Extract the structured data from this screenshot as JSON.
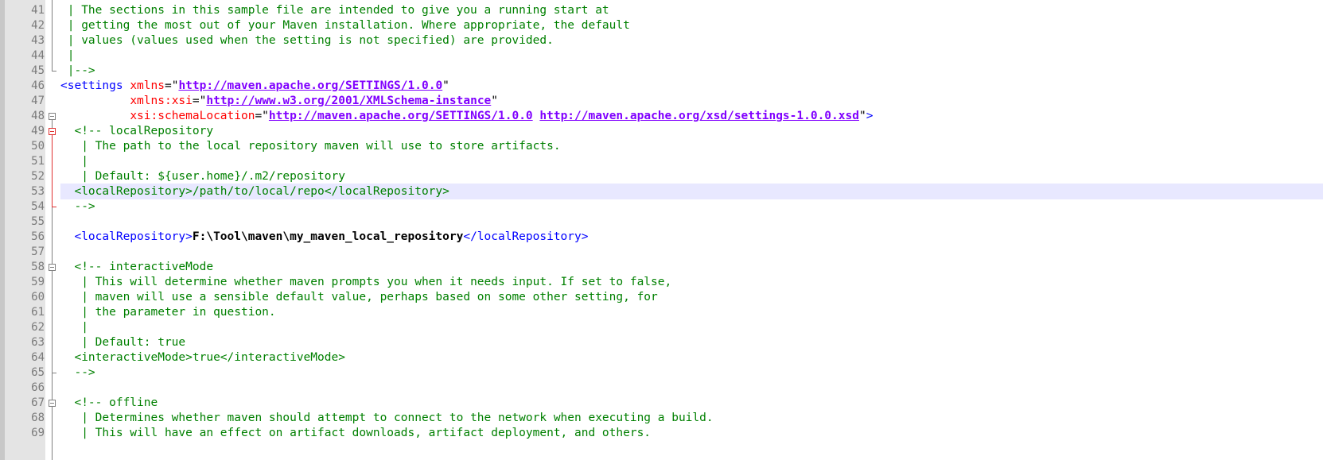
{
  "editor": {
    "colors": {
      "comment": "#008000",
      "tag": "#0000ff",
      "attribute": "#ff0000",
      "url": "#8000ff",
      "current_line": "#e8e8ff",
      "gutter": "#e4e4e4"
    },
    "current_line": 53,
    "lines": [
      {
        "n": "41",
        "indent": "",
        "parts": [
          {
            "c": "comment",
            "t": " | The sections in this sample file are intended to give you a running start at"
          }
        ]
      },
      {
        "n": "42",
        "indent": "",
        "parts": [
          {
            "c": "comment",
            "t": " | getting the most out of your Maven installation. Where appropriate, the default"
          }
        ]
      },
      {
        "n": "43",
        "indent": "",
        "parts": [
          {
            "c": "comment",
            "t": " | values (values used when the setting is not specified) are provided."
          }
        ]
      },
      {
        "n": "44",
        "indent": "",
        "parts": [
          {
            "c": "comment",
            "t": " |"
          }
        ]
      },
      {
        "n": "45",
        "indent": "",
        "parts": [
          {
            "c": "comment",
            "t": " |-->"
          }
        ]
      },
      {
        "n": "46",
        "indent": "",
        "parts": [
          {
            "c": "tag",
            "t": "<settings "
          },
          {
            "c": "attr",
            "t": "xmlns"
          },
          {
            "c": "punct",
            "t": "=\""
          },
          {
            "c": "url",
            "t": "http://maven.apache.org/SETTINGS/1.0.0"
          },
          {
            "c": "punct",
            "t": "\""
          }
        ]
      },
      {
        "n": "47",
        "indent": "          ",
        "parts": [
          {
            "c": "attr",
            "t": "xmlns:xsi"
          },
          {
            "c": "punct",
            "t": "=\""
          },
          {
            "c": "url",
            "t": "http://www.w3.org/2001/XMLSchema-instance"
          },
          {
            "c": "punct",
            "t": "\""
          }
        ]
      },
      {
        "n": "48",
        "indent": "          ",
        "parts": [
          {
            "c": "attr",
            "t": "xsi:schemaLocation"
          },
          {
            "c": "punct",
            "t": "=\""
          },
          {
            "c": "url",
            "t": "http://maven.apache.org/SETTINGS/1.0.0"
          },
          {
            "c": "punct",
            "t": " "
          },
          {
            "c": "url",
            "t": "http://maven.apache.org/xsd/settings-1.0.0.xsd"
          },
          {
            "c": "punct",
            "t": "\""
          },
          {
            "c": "tag",
            "t": ">"
          }
        ]
      },
      {
        "n": "49",
        "indent": "  ",
        "parts": [
          {
            "c": "comment",
            "t": "<!-- localRepository"
          }
        ]
      },
      {
        "n": "50",
        "indent": "  ",
        "parts": [
          {
            "c": "comment",
            "t": " | The path to the local repository maven will use to store artifacts."
          }
        ]
      },
      {
        "n": "51",
        "indent": "  ",
        "parts": [
          {
            "c": "comment",
            "t": " |"
          }
        ]
      },
      {
        "n": "52",
        "indent": "  ",
        "parts": [
          {
            "c": "comment",
            "t": " | Default: ${user.home}/.m2/repository"
          }
        ]
      },
      {
        "n": "53",
        "indent": "  ",
        "parts": [
          {
            "c": "comment",
            "t": "<localRepository>/path/to/local/repo</localRepository>"
          }
        ]
      },
      {
        "n": "54",
        "indent": "  ",
        "parts": [
          {
            "c": "comment",
            "t": "-->"
          }
        ]
      },
      {
        "n": "55",
        "indent": "",
        "parts": []
      },
      {
        "n": "56",
        "indent": "  ",
        "parts": [
          {
            "c": "tag",
            "t": "<localRepository>"
          },
          {
            "c": "text-bold",
            "t": "F:\\Tool\\maven\\my_maven_local_repository"
          },
          {
            "c": "tag",
            "t": "</localRepository>"
          }
        ]
      },
      {
        "n": "57",
        "indent": "",
        "parts": []
      },
      {
        "n": "58",
        "indent": "  ",
        "parts": [
          {
            "c": "comment",
            "t": "<!-- interactiveMode"
          }
        ]
      },
      {
        "n": "59",
        "indent": "  ",
        "parts": [
          {
            "c": "comment",
            "t": " | This will determine whether maven prompts you when it needs input. If set to false,"
          }
        ]
      },
      {
        "n": "60",
        "indent": "  ",
        "parts": [
          {
            "c": "comment",
            "t": " | maven will use a sensible default value, perhaps based on some other setting, for"
          }
        ]
      },
      {
        "n": "61",
        "indent": "  ",
        "parts": [
          {
            "c": "comment",
            "t": " | the parameter in question."
          }
        ]
      },
      {
        "n": "62",
        "indent": "  ",
        "parts": [
          {
            "c": "comment",
            "t": " |"
          }
        ]
      },
      {
        "n": "63",
        "indent": "  ",
        "parts": [
          {
            "c": "comment",
            "t": " | Default: true"
          }
        ]
      },
      {
        "n": "64",
        "indent": "  ",
        "parts": [
          {
            "c": "comment",
            "t": "<interactiveMode>true</interactiveMode>"
          }
        ]
      },
      {
        "n": "65",
        "indent": "  ",
        "parts": [
          {
            "c": "comment",
            "t": "-->"
          }
        ]
      },
      {
        "n": "66",
        "indent": "",
        "parts": []
      },
      {
        "n": "67",
        "indent": "  ",
        "parts": [
          {
            "c": "comment",
            "t": "<!-- offline"
          }
        ]
      },
      {
        "n": "68",
        "indent": "  ",
        "parts": [
          {
            "c": "comment",
            "t": " | Determines whether maven should attempt to connect to the network when executing a build."
          }
        ]
      },
      {
        "n": "69",
        "indent": "  ",
        "parts": [
          {
            "c": "comment",
            "t": " | This will have an effect on artifact downloads, artifact deployment, and others."
          }
        ]
      }
    ]
  }
}
